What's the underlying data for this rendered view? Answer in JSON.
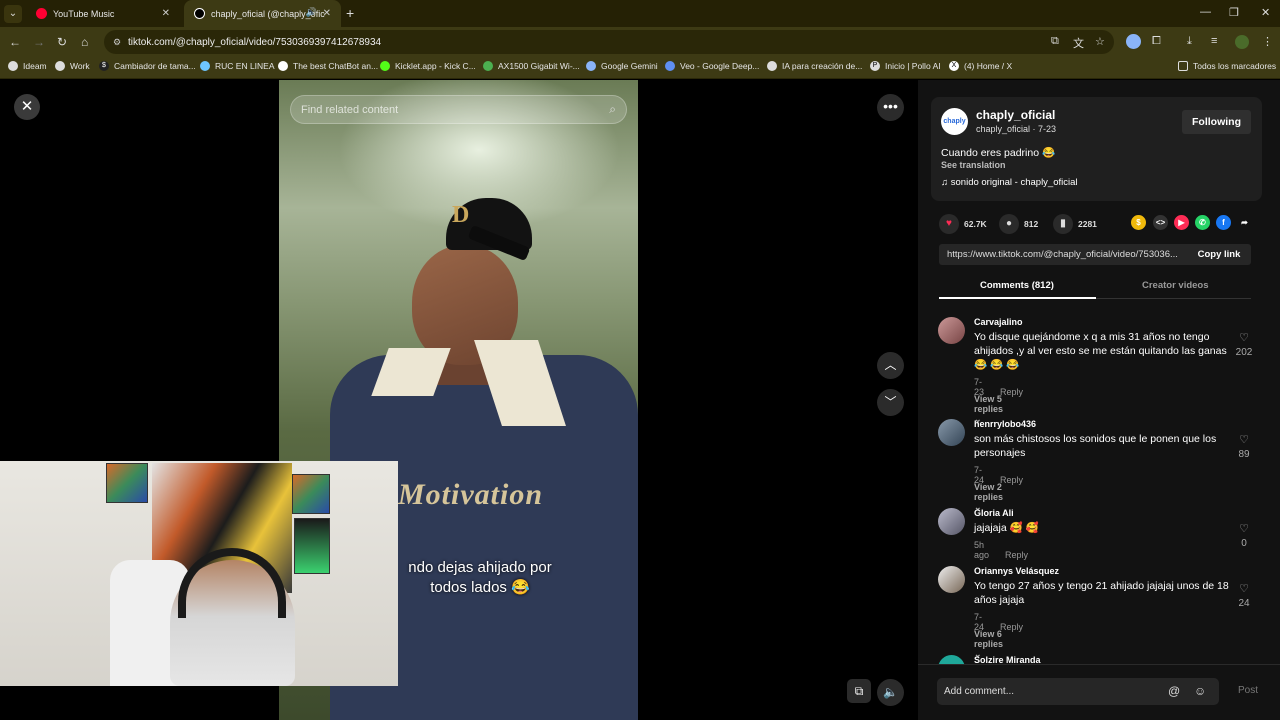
{
  "browser": {
    "tabs": [
      {
        "title": "YouTube Music",
        "color": "#ff0033"
      },
      {
        "title": "chaply_oficial (@chaply_ofic",
        "color": "#000000"
      }
    ],
    "url": "tiktok.com/@chaply_oficial/video/7530369397412678934",
    "bookmarks": [
      "Ideam",
      "Work",
      "Cambiador de tama...",
      "RUC EN LINEA",
      "The best ChatBot an...",
      "Kicklet.app - Kick C...",
      "AX1500 Gigabit Wi-...",
      "Google Gemini",
      "Veo - Google Deep...",
      "IA para creación de...",
      "Inicio | Pollo AI",
      "(4) Home / X"
    ],
    "all_bookmarks": "Todos los marcadores"
  },
  "video": {
    "search_placeholder": "Find related content",
    "subtitle": "ndo dejas ahijado por todos lados 😂",
    "shirt_text": "Motivation",
    "cap_logo": "D"
  },
  "post": {
    "avatar_text": "chaply",
    "username": "chaply_oficial",
    "meta": "chaply_oficial · 7-23",
    "follow_label": "Following",
    "description": "Cuando eres padrino 😂",
    "see_translation": "See translation",
    "music": "sonido original - chaply_oficial",
    "likes": "62.7K",
    "comments": "812",
    "saves": "2281",
    "link": "https://www.tiktok.com/@chaply_oficial/video/753036...",
    "copy_link": "Copy link",
    "share_colors": [
      "#f0b90b",
      "#333333",
      "#fe2c55",
      "#25d366",
      "#1877f2"
    ]
  },
  "tabs": {
    "comments": "Comments (812)",
    "creator": "Creator videos"
  },
  "comments": [
    {
      "name": "Carvajalino",
      "text": "Yo disque quejándome x q a mis 31 años no tengo ahijados ,y al ver esto se me están quitando las ganas 😂 😂 😂",
      "date": "7-23",
      "reply": "Reply",
      "replies": "View 5 replies",
      "likes": "202"
    },
    {
      "name": "henrrylobo436",
      "text": "son más chistosos los sonidos que le ponen que los personajes",
      "date": "7-24",
      "reply": "Reply",
      "replies": "View 2 replies",
      "likes": "89"
    },
    {
      "name": "Gloria Ali",
      "text": "jajajaja 🥰 🥰",
      "date": "5h ago",
      "reply": "Reply",
      "replies": "",
      "likes": "0"
    },
    {
      "name": "Oriannys Velásquez",
      "text": "Yo tengo 27 años y tengo 21 ahijado jajajaj unos de 18 años jajaja",
      "date": "7-24",
      "reply": "Reply",
      "replies": "View 6 replies",
      "likes": "24"
    },
    {
      "name": "Solzire Miranda",
      "text": "",
      "date": "",
      "reply": "",
      "replies": "",
      "likes": ""
    }
  ],
  "composer": {
    "placeholder": "Add comment...",
    "post": "Post"
  }
}
